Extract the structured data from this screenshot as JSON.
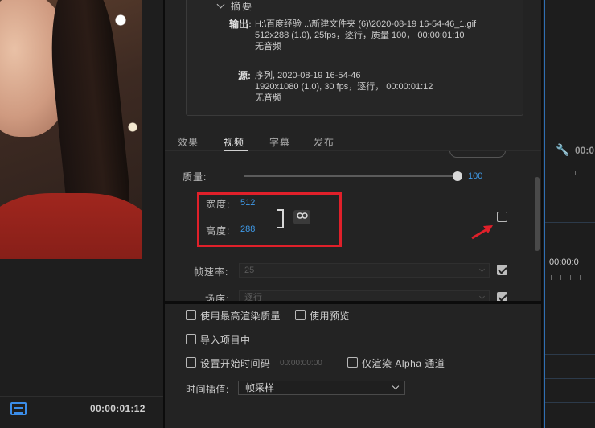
{
  "summary": {
    "heading": "摘要",
    "output_label": "输出:",
    "output_path": "H:\\百度经验 ..\\新建文件夹 (6)\\2020-08-19  16-54-46_1.gif",
    "output_specs": "512x288  (1.0),  25fps，逐行，质量 100，  00:00:01:10",
    "output_audio": "无音频",
    "source_label": "源:",
    "source_name": "序列, 2020-08-19 16-54-46",
    "source_specs": "1920x1080  (1.0),  30 fps，逐行，  00:00:01:12",
    "source_audio": "无音频"
  },
  "tabs": [
    {
      "label": "效果"
    },
    {
      "label": "视频"
    },
    {
      "label": "字幕"
    },
    {
      "label": "发布"
    }
  ],
  "video": {
    "quality_label": "质量:",
    "quality_value": "100",
    "quality_fraction": 1.0,
    "width_label": "宽度:",
    "width_value": "512",
    "height_label": "高度:",
    "height_value": "288",
    "link_icon": "link-icon",
    "framerate_label": "帧速率:",
    "framerate_value": "25",
    "field_label": "场序:",
    "field_value": "逐行"
  },
  "options": {
    "max_render_quality": "使用最高渲染质量",
    "use_previews": "使用预览",
    "import_into_project": "导入项目中",
    "set_start_timecode": "设置开始时间码",
    "start_timecode_value": "00:00:00:00",
    "render_alpha_only": "仅渲染 Alpha 通道",
    "time_interpolation_label": "时间插值:",
    "time_interpolation_value": "帧采样"
  },
  "left_panel": {
    "timecode": "00:00:01:12"
  },
  "right_panel": {
    "timecode_top": "00:0",
    "timecode_ruler": "00:00:0"
  },
  "colors": {
    "accent_blue": "#3f9ae8",
    "highlight_red": "#e0202a"
  }
}
